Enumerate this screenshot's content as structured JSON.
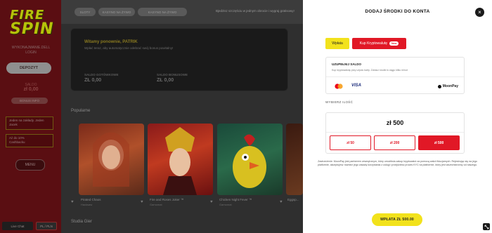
{
  "sidebar": {
    "logo_line1": "FIRE",
    "logo_line2": "SPIN",
    "username": "WYKONAJMANIE.DELL",
    "user_sub": "LOGIN",
    "deposit_label": "DEPOZYT",
    "balance_label": "SALDO",
    "balance_value": "zł 0,00",
    "balance_sub": "zł 0,00",
    "bonus_button": "BONUS INFO",
    "card1": "Jeden na zakłady. Jeden",
    "card1_sub": "Jacek",
    "card2": "Aż do 10%",
    "card2_sub": "Cashbacku",
    "menu_label": "MENU",
    "live_chat": "Live Chat",
    "language": "PL / PLN"
  },
  "topnav": {
    "tabs": [
      "SLOTY",
      "KASYNO NA ŻYWO",
      "KASYNO NA ŻYWO"
    ],
    "promo": "Bjedzisz szczęściu w jednym obrocie i wygraj gratisowy!"
  },
  "hero": {
    "greeting": "Witamy ponownie, PATRIK",
    "subtitle": "Wpłać teraz, aby automatycznie odebrać swój bonus powitalny!",
    "cash_label": "SALDO GOTÓWKOWE",
    "cash_value": "ZŁ 0,00",
    "bonus_label": "SALDO BONUSOWE",
    "bonus_value": "ZŁ 0,00"
  },
  "sections": {
    "popular": "Popularne",
    "studios": "Studia Gier"
  },
  "games": [
    {
      "title": "Pirated Chaos",
      "provider": "Hacksaw"
    },
    {
      "title": "Fire and Roses Joker ™",
      "provider": "Gamomat"
    },
    {
      "title": "Chicken Night Fever ™",
      "provider": "Gamomat"
    },
    {
      "title": "Eggsp...",
      "provider": ""
    }
  ],
  "modal": {
    "title": "DODAJ ŚRODKI DO KONTA",
    "close": "×",
    "tab_deposit": "Wpłata",
    "tab_crypto": "Kup Kryptowalutę",
    "tab_crypto_badge": "New",
    "topup_title": "UZUPEŁNIJ SALDO",
    "topup_desc": "Kup kryptowalutę przy użyciu karty. Zobacz środki w ciągu kilku minut",
    "visa": "VISA",
    "moonpay": "MoonPay",
    "amount_label": "WYBIERZ ILOŚĆ",
    "amount_value": "zł 500",
    "options": [
      "zł 50",
      "zł 200",
      "zł 500"
    ],
    "selected_option": 2,
    "disclaimer": "Zastrzeżenie: MoonPay jest partnerem zewnętrznym, który umożliwia zakup kryptowalut za pomocą walut fiducjarnych. Rejestrując się na jego platformie, akceptujesz również jego zasady korzystania z usługi i przejdziesz proces KYC na platformie, który jest wszechstronny od naszego.",
    "pay_button": "WPŁATA ZŁ 500.00"
  },
  "colors": {
    "accent_yellow": "#f2e21c",
    "accent_red": "#e11826"
  },
  "icons": {
    "close": "close-icon",
    "mastercard": "mastercard-icon",
    "moonpay": "moonpay-icon",
    "corner": "corner-action-icon"
  }
}
